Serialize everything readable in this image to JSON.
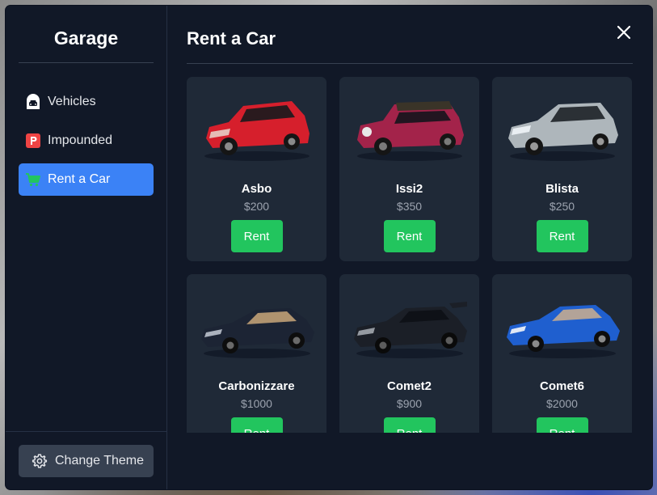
{
  "sidebar": {
    "title": "Garage",
    "items": [
      {
        "label": "Vehicles",
        "icon": "car-garage-icon",
        "active": false
      },
      {
        "label": "Impounded",
        "icon": "parking-icon",
        "active": false
      },
      {
        "label": "Rent a Car",
        "icon": "cart-icon",
        "active": true
      }
    ],
    "theme_button": "Change Theme"
  },
  "main": {
    "title": "Rent a Car",
    "rent_label": "Rent",
    "cars": [
      {
        "name": "Asbo",
        "price": "$200",
        "color": "#d61f2c"
      },
      {
        "name": "Issi2",
        "price": "$350",
        "color": "#a3234a"
      },
      {
        "name": "Blista",
        "price": "$250",
        "color": "#aeb6bb"
      },
      {
        "name": "Carbonizzare",
        "price": "$1000",
        "color": "#1c2434"
      },
      {
        "name": "Comet2",
        "price": "$900",
        "color": "#1b1f27"
      },
      {
        "name": "Comet6",
        "price": "$2000",
        "color": "#1f5fcf"
      }
    ]
  },
  "colors": {
    "panel": "#111827",
    "card": "#1f2937",
    "accent": "#3b82f6",
    "rent": "#22c55e"
  }
}
